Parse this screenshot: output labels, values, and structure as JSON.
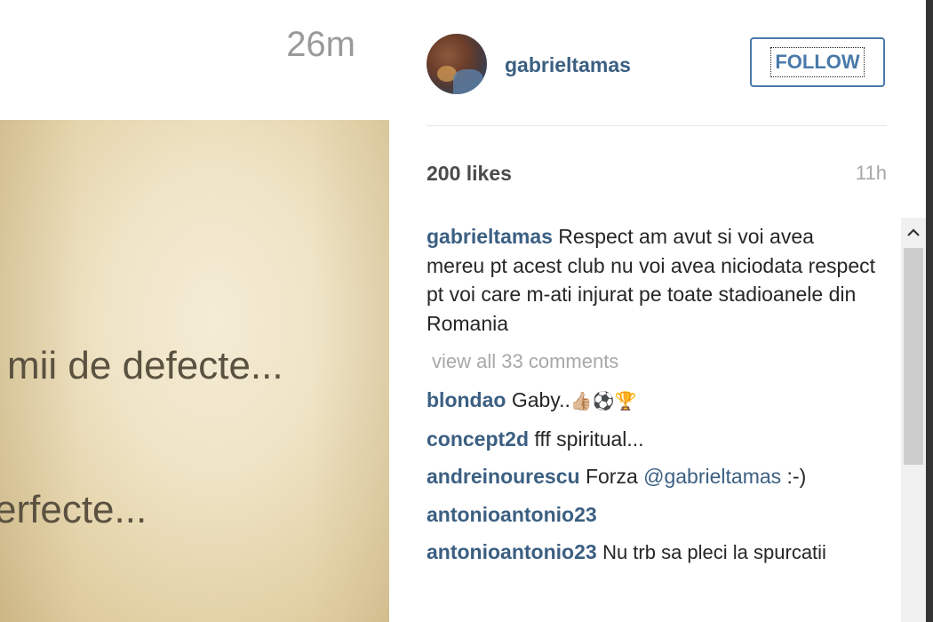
{
  "left": {
    "time": "26m",
    "photo_text": [
      "mii de defecte...",
      "erfecte..."
    ]
  },
  "header": {
    "username": "gabrieltamas",
    "follow_label": "FOLLOW"
  },
  "stats": {
    "likes": "200 likes",
    "time": "11h"
  },
  "caption": {
    "user": "gabrieltamas",
    "text": "Respect am avut si voi avea mereu pt acest club nu voi avea niciodata respect pt voi care m-ati injurat pe toate stadioanele din Romania"
  },
  "view_all": "view all 33 comments",
  "comments": [
    {
      "user": "blondao",
      "text": "Gaby..",
      "emoji": "👍🏼⚽🏆"
    },
    {
      "user": "concept2d",
      "text": "fff spiritual..."
    },
    {
      "user": "andreinourescu",
      "text": "Forza",
      "mention": "@gabrieltamas",
      "suffix": ":-)"
    },
    {
      "user": "antonioantonio23",
      "text": ""
    },
    {
      "user": "antonioantonio23",
      "text": "Nu trb sa pleci la spurcatii"
    }
  ],
  "icons": {
    "scroll_up": "chevron-up-icon"
  },
  "colors": {
    "link": "#3b5f82",
    "follow": "#4a7aa9",
    "muted": "#a8a8a8",
    "text": "#262626"
  }
}
